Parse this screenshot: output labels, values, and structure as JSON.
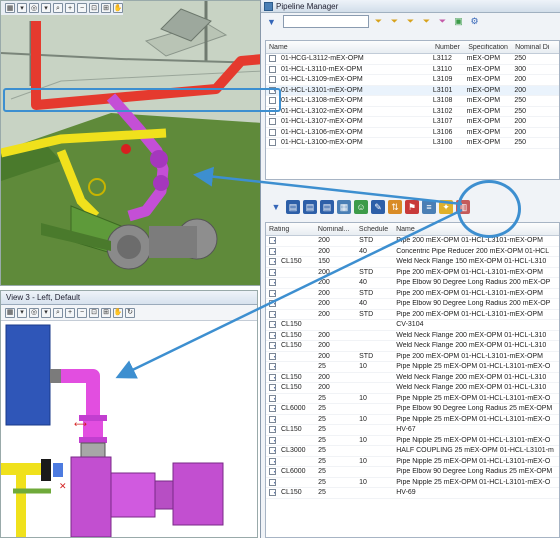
{
  "view_top": {
    "toolbar_icons": [
      "view-icon",
      "dropdown-icon",
      "orbit-icon",
      "dropdown-icon",
      "zoom-icon",
      "zoom-in-icon",
      "zoom-out-icon",
      "zoom-window-icon",
      "zoom-extents-icon",
      "pan-icon"
    ]
  },
  "view_bottom": {
    "title": "View 3 - Left, Default",
    "toolbar_icons": [
      "view-icon",
      "dropdown-icon",
      "orbit-icon",
      "dropdown-icon",
      "zoom-icon",
      "zoom-in-icon",
      "zoom-out-icon",
      "zoom-window-icon",
      "zoom-extents-icon",
      "pan-icon",
      "orbit-icon"
    ]
  },
  "pipeline_manager": {
    "title": "Pipeline Manager",
    "lines_table": {
      "columns": [
        "Name",
        "Number",
        "Specification",
        "Nominal Di"
      ],
      "rows": [
        {
          "name": "01-HCG-L3112-mEX-OPM",
          "number": "L3112",
          "spec": "mEX-OPM",
          "nd": "250",
          "checked": false
        },
        {
          "name": "01-HCL-L3110-mEX-OPM",
          "number": "L3110",
          "spec": "mEX-OPM",
          "nd": "300",
          "checked": false
        },
        {
          "name": "01-HCL-L3109-mEX-OPM",
          "number": "L3109",
          "spec": "mEX-OPM",
          "nd": "200",
          "checked": false
        },
        {
          "name": "01-HCL-L3101-mEX-OPM",
          "number": "L3101",
          "spec": "mEX-OPM",
          "nd": "200",
          "checked": true
        },
        {
          "name": "01-HCL-L3108-mEX-OPM",
          "number": "L3108",
          "spec": "mEX-OPM",
          "nd": "250",
          "checked": false
        },
        {
          "name": "01-HCL-L3102-mEX-OPM",
          "number": "L3102",
          "spec": "mEX-OPM",
          "nd": "250",
          "checked": false
        },
        {
          "name": "01-HCL-L3107-mEX-OPM",
          "number": "L3107",
          "spec": "mEX-OPM",
          "nd": "200",
          "checked": false
        },
        {
          "name": "01-HCL-L3106-mEX-OPM",
          "number": "L3106",
          "spec": "mEX-OPM",
          "nd": "200",
          "checked": false
        },
        {
          "name": "01-HCL-L3100-mEX-OPM",
          "number": "L3100",
          "spec": "mEX-OPM",
          "nd": "250",
          "checked": false
        }
      ]
    },
    "components_table": {
      "columns": [
        "Rating",
        "Nominal...",
        "Schedule",
        "Name"
      ],
      "rows": [
        {
          "rating": "",
          "nominal": "200",
          "schedule": "STD",
          "name": "Pipe 200 mEX-OPM 01-HCL-L3101-mEX-OPM"
        },
        {
          "rating": "",
          "nominal": "200",
          "schedule": "40",
          "name": "Concentric Pipe Reducer 200 mEX-OPM 01-HCL"
        },
        {
          "rating": "CL150",
          "nominal": "150",
          "schedule": "",
          "name": "Weld Neck Flange 150 mEX-OPM 01-HCL-L310"
        },
        {
          "rating": "",
          "nominal": "200",
          "schedule": "STD",
          "name": "Pipe 200 mEX-OPM 01-HCL-L3101-mEX-OPM"
        },
        {
          "rating": "",
          "nominal": "200",
          "schedule": "40",
          "name": "Pipe Elbow 90 Degree Long Radius 200 mEX-OP"
        },
        {
          "rating": "",
          "nominal": "200",
          "schedule": "STD",
          "name": "Pipe 200 mEX-OPM 01-HCL-L3101-mEX-OPM"
        },
        {
          "rating": "",
          "nominal": "200",
          "schedule": "40",
          "name": "Pipe Elbow 90 Degree Long Radius 200 mEX-OP"
        },
        {
          "rating": "",
          "nominal": "200",
          "schedule": "STD",
          "name": "Pipe 200 mEX-OPM 01-HCL-L3101-mEX-OPM"
        },
        {
          "rating": "CL150",
          "nominal": "",
          "schedule": "",
          "name": "CV-3104"
        },
        {
          "rating": "CL150",
          "nominal": "200",
          "schedule": "",
          "name": "Weld Neck Flange 200 mEX-OPM 01-HCL-L310"
        },
        {
          "rating": "CL150",
          "nominal": "200",
          "schedule": "",
          "name": "Weld Neck Flange 200 mEX-OPM 01-HCL-L310"
        },
        {
          "rating": "",
          "nominal": "200",
          "schedule": "STD",
          "name": "Pipe 200 mEX-OPM 01-HCL-L3101-mEX-OPM"
        },
        {
          "rating": "",
          "nominal": "25",
          "schedule": "10",
          "name": "Pipe Nipple 25 mEX-OPM 01-HCL-L3101-mEX-O"
        },
        {
          "rating": "CL150",
          "nominal": "200",
          "schedule": "",
          "name": "Weld Neck Flange 200 mEX-OPM 01-HCL-L310"
        },
        {
          "rating": "CL150",
          "nominal": "200",
          "schedule": "",
          "name": "Weld Neck Flange 200 mEX-OPM 01-HCL-L310"
        },
        {
          "rating": "",
          "nominal": "25",
          "schedule": "10",
          "name": "Pipe Nipple 25 mEX-OPM 01-HCL-L3101-mEX-O"
        },
        {
          "rating": "CL6000",
          "nominal": "25",
          "schedule": "",
          "name": "Pipe Elbow 90 Degree Long Radius 25 mEX-OPM"
        },
        {
          "rating": "",
          "nominal": "25",
          "schedule": "10",
          "name": "Pipe Nipple 25 mEX-OPM 01-HCL-L3101-mEX-O"
        },
        {
          "rating": "CL150",
          "nominal": "25",
          "schedule": "",
          "name": "HV-67"
        },
        {
          "rating": "",
          "nominal": "25",
          "schedule": "10",
          "name": "Pipe Nipple 25 mEX-OPM 01-HCL-L3101-mEX-O"
        },
        {
          "rating": "CL3000",
          "nominal": "25",
          "schedule": "",
          "name": "HALF COUPLING 25 mEX-OPM 01-HCL-L3101-m"
        },
        {
          "rating": "",
          "nominal": "25",
          "schedule": "10",
          "name": "Pipe Nipple 25 mEX-OPM 01-HCL-L3101-mEX-O"
        },
        {
          "rating": "CL6000",
          "nominal": "25",
          "schedule": "",
          "name": "Pipe Elbow 90 Degree Long Radius 25 mEX-OPM"
        },
        {
          "rating": "",
          "nominal": "25",
          "schedule": "10",
          "name": "Pipe Nipple 25 mEX-OPM 01-HCL-L3101-mEX-O"
        },
        {
          "rating": "CL150",
          "nominal": "25",
          "schedule": "",
          "name": "HV-69"
        }
      ]
    },
    "toolbar_icons": [
      "filter-icon",
      "funnel-icon",
      "funnel-add-icon",
      "funnel-remove-icon",
      "funnel-clear-icon",
      "funnel-edit-icon",
      "export-icon",
      "settings-icon"
    ],
    "component_toolbar_icons": [
      "filter-icon",
      "table-icon",
      "table-icon",
      "table-icon",
      "grid-icon",
      "people-icon",
      "edit-icon",
      "sort-icon",
      "flag-icon",
      "spec-icon",
      "highlight-icon",
      "report-icon"
    ]
  },
  "colors": {
    "highlight_blue": "#3d8fd0",
    "pipe_red": "#e53a2e",
    "pipe_magenta": "#c44fd6",
    "pipe_yellow": "#f0e11c",
    "pipe_green": "#6faa3a"
  }
}
